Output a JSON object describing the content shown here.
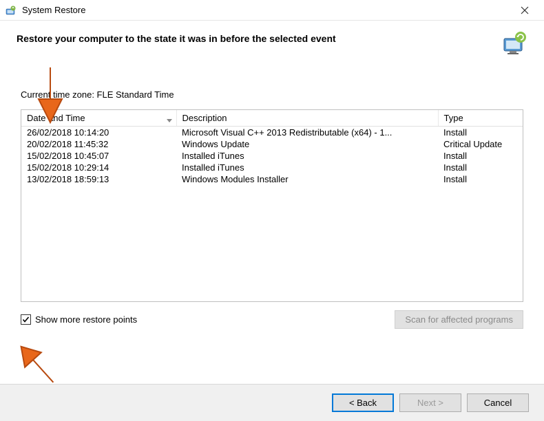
{
  "window": {
    "title": "System Restore",
    "header": "Restore your computer to the state it was in before the selected event"
  },
  "timezone_label": "Current time zone: FLE Standard Time",
  "columns": {
    "date": "Date and Time",
    "desc": "Description",
    "type": "Type"
  },
  "rows": [
    {
      "date": "26/02/2018 10:14:20",
      "desc": "Microsoft Visual C++ 2013 Redistributable (x64) - 1...",
      "type": "Install"
    },
    {
      "date": "20/02/2018 11:45:32",
      "desc": "Windows Update",
      "type": "Critical Update"
    },
    {
      "date": "15/02/2018 10:45:07",
      "desc": "Installed iTunes",
      "type": "Install"
    },
    {
      "date": "15/02/2018 10:29:14",
      "desc": "Installed iTunes",
      "type": "Install"
    },
    {
      "date": "13/02/2018 18:59:13",
      "desc": "Windows Modules Installer",
      "type": "Install"
    }
  ],
  "checkbox": {
    "label": "Show more restore points",
    "checked": true
  },
  "buttons": {
    "scan": "Scan for affected programs",
    "back": "< Back",
    "next": "Next >",
    "cancel": "Cancel"
  }
}
